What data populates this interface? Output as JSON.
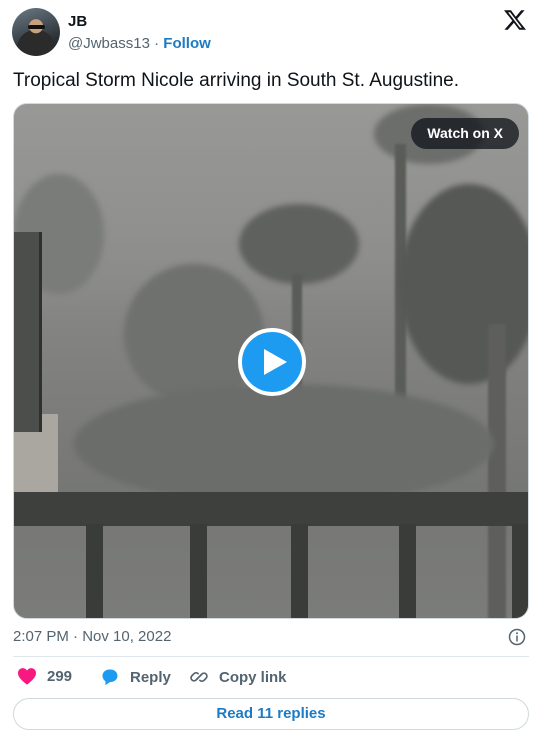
{
  "author": {
    "name": "JB",
    "handle": "@Jwbass13",
    "separator": " · ",
    "follow_label": "Follow"
  },
  "tweet": {
    "text": "Tropical Storm Nicole arriving in South St. Augustine."
  },
  "media": {
    "watch_label": "Watch on X"
  },
  "meta": {
    "timestamp": "2:07 PM · Nov 10, 2022"
  },
  "actions": {
    "like_count": "299",
    "reply_label": "Reply",
    "copy_link_label": "Copy link"
  },
  "footer": {
    "read_replies_label": "Read 11 replies"
  },
  "colors": {
    "accent": "#1d9bf0",
    "like": "#f91880",
    "link": "#1d7bc4"
  },
  "icons": [
    "x-logo-icon",
    "play-icon",
    "info-icon",
    "heart-icon",
    "reply-bubble-icon",
    "link-icon"
  ]
}
